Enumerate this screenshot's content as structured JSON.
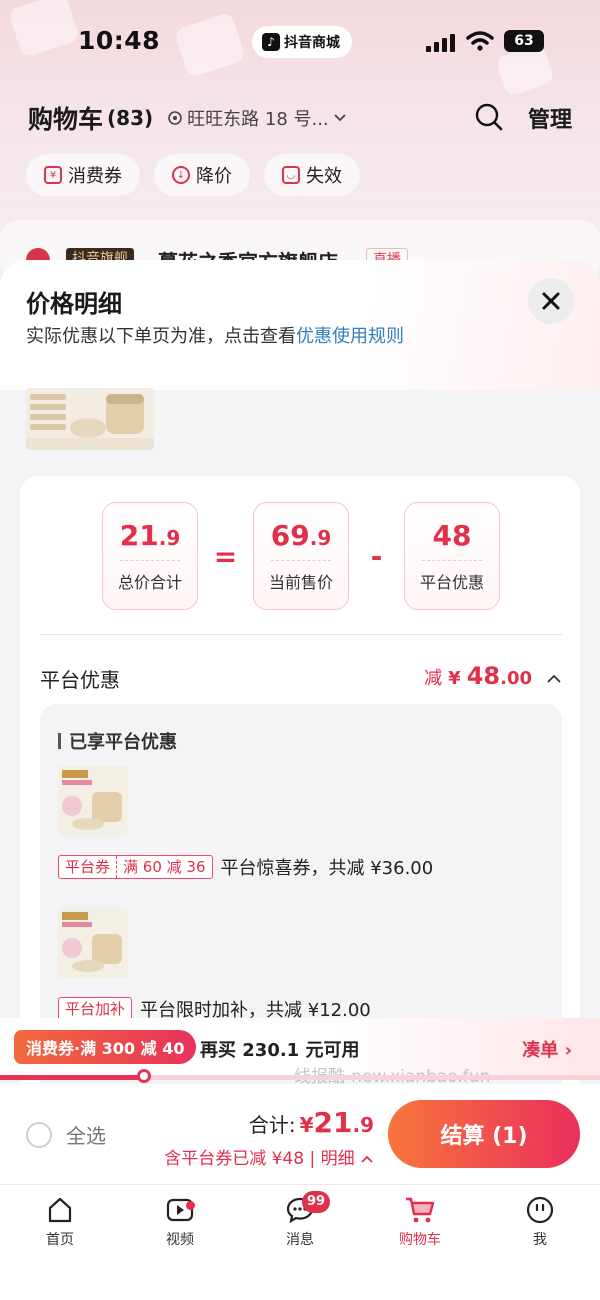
{
  "status_bar": {
    "time": "10:48",
    "app_pill": "抖音商城",
    "battery": "63"
  },
  "cart": {
    "title": "购物车",
    "count": "(83)",
    "address": "旺旺东路 18 号...",
    "manage_label": "管理",
    "filters": [
      "消费券",
      "降价",
      "失效"
    ],
    "shop_badge": "抖音旗舰",
    "shop_name": "蔓花之秀官方旗舰店",
    "live_tag": "直播"
  },
  "sheet": {
    "title": "价格明细",
    "subtitle": "实际优惠以下单页为准，点击查看",
    "rule_link": "优惠使用规则",
    "formula": {
      "total": {
        "int": "21",
        "dec": ".9",
        "label": "总价合计"
      },
      "op1": "=",
      "current": {
        "int": "69",
        "dec": ".9",
        "label": "当前售价"
      },
      "op2": "-",
      "discount": {
        "int": "48",
        "label": "平台优惠"
      }
    },
    "section_title": "平台优惠",
    "section_amount": {
      "reduce": "减",
      "yen": "¥",
      "int": "48",
      "dec": ".00"
    },
    "inner_title": "已享平台优惠",
    "coupons": [
      {
        "tag": "平台券",
        "tag_detail": "满 60 减 36",
        "text": "平台惊喜券，共减 ¥36.00"
      },
      {
        "tag": "平台加补",
        "tag_detail": "",
        "text": "平台限时加补，共减 ¥12.00"
      }
    ]
  },
  "promo": {
    "tag": "消费券·满 300 减 40",
    "text": "再买 230.1 元可用",
    "link": "凑单",
    "watermark": "线报酷-new.xianbao.fun",
    "progress": 0.24
  },
  "checkout": {
    "select_all": "全选",
    "total_label": "合计:",
    "yen": "¥",
    "total_int": "21",
    "total_dec": ".9",
    "note": "含平台券已减 ¥48 | 明细",
    "pay_label": "结算 (1)"
  },
  "tabs": [
    {
      "label": "首页",
      "icon": "home-icon"
    },
    {
      "label": "视频",
      "icon": "video-icon"
    },
    {
      "label": "消息",
      "icon": "message-icon",
      "badge": "99"
    },
    {
      "label": "购物车",
      "icon": "cart-icon",
      "active": true
    },
    {
      "label": "我",
      "icon": "profile-icon"
    }
  ],
  "colors": {
    "accent": "#e0304c",
    "link": "#2f7fc1",
    "gradient_start": "#f7753b",
    "gradient_end": "#ea2f5d"
  }
}
